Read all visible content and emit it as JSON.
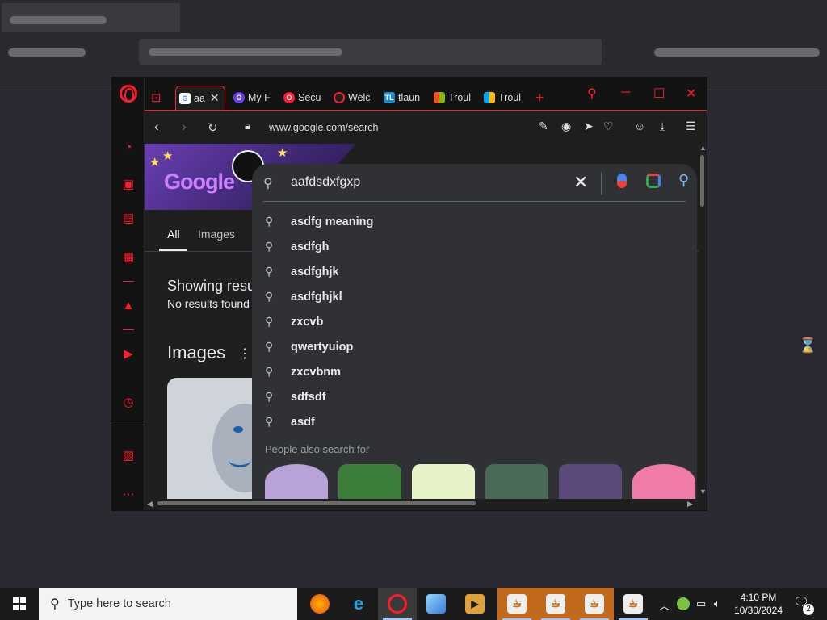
{
  "browser": {
    "tabs": [
      {
        "label": "aa",
        "favicon": "G",
        "active": true
      },
      {
        "label": "My F",
        "favicon": "O"
      },
      {
        "label": "Secu",
        "favicon": "O"
      },
      {
        "label": "Welc",
        "favicon": "O"
      },
      {
        "label": "tlaun",
        "favicon": "TL"
      },
      {
        "label": "Troul",
        "favicon": "MS"
      },
      {
        "label": "Troul",
        "favicon": "MS"
      }
    ],
    "new_tab": "+",
    "url": "www.google.com/search"
  },
  "google": {
    "doodle_text": "Google",
    "result_tabs": [
      "All",
      "Images"
    ],
    "showing": "Showing resu",
    "no_results": "No results found",
    "images_heading": "Images",
    "search_query": "aafdsdxfgxp",
    "suggestions": [
      "asdfg meaning",
      "asdfgh",
      "asdfghjk",
      "asdfghjkl",
      "zxcvb",
      "qwertyuiop",
      "zxcvbnm",
      "sdfsdf",
      "asdf"
    ],
    "people_also_search": "People also search for",
    "thumbnails": [
      "#b9a2d8",
      "#3c7d3a",
      "#e6f2c8",
      "#4a6a58",
      "#5b4a7a",
      "#f07aa8"
    ]
  },
  "taskbar": {
    "search_placeholder": "Type here to search",
    "time": "4:10 PM",
    "date": "10/30/2024",
    "notification_count": "2"
  }
}
